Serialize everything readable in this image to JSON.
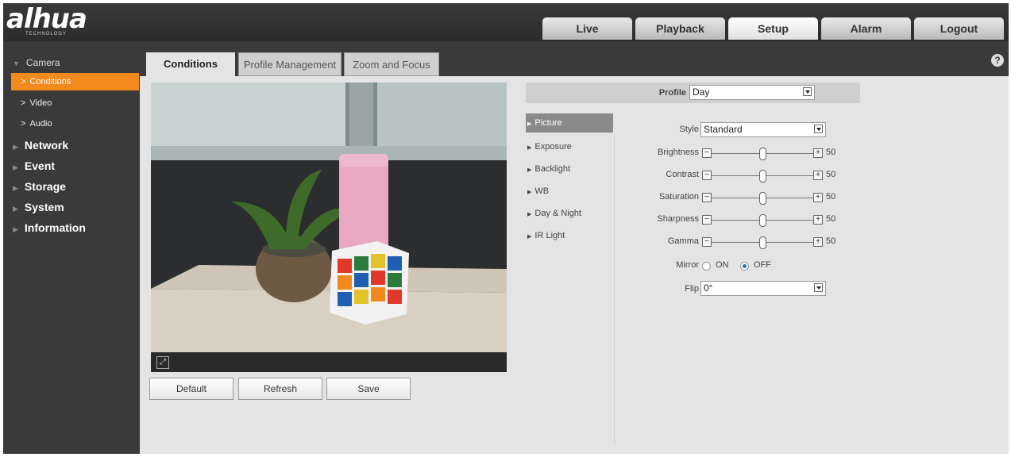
{
  "header": {
    "logo": "alhua",
    "logo_sub": "TECHNOLOGY",
    "tabs": [
      {
        "label": "Live"
      },
      {
        "label": "Playback"
      },
      {
        "label": "Setup"
      },
      {
        "label": "Alarm"
      },
      {
        "label": "Logout"
      }
    ],
    "active_tab": "Setup"
  },
  "sidebar": {
    "camera": "Camera",
    "camera_items": [
      "Conditions",
      "Video",
      "Audio"
    ],
    "active_item": "Conditions",
    "sections": [
      "Network",
      "Event",
      "Storage",
      "System",
      "Information"
    ]
  },
  "subtabs": [
    "Conditions",
    "Profile Management",
    "Zoom and Focus"
  ],
  "help_icon": "?",
  "buttons": {
    "default": "Default",
    "refresh": "Refresh",
    "save": "Save"
  },
  "profile": {
    "label": "Profile",
    "value": "Day"
  },
  "menu": [
    "Picture",
    "Exposure",
    "Backlight",
    "WB",
    "Day & Night",
    "IR Light"
  ],
  "picture": {
    "style": {
      "label": "Style",
      "value": "Standard"
    },
    "sliders": [
      {
        "label": "Brightness",
        "value": "50"
      },
      {
        "label": "Contrast",
        "value": "50"
      },
      {
        "label": "Saturation",
        "value": "50"
      },
      {
        "label": "Sharpness",
        "value": "50"
      },
      {
        "label": "Gamma",
        "value": "50"
      }
    ],
    "mirror": {
      "label": "Mirror",
      "on": "ON",
      "off": "OFF",
      "selected": "OFF"
    },
    "flip": {
      "label": "Flip",
      "value": "0°"
    }
  },
  "colors": {
    "accent": "#f28a1d",
    "header": "#3a3a3a",
    "panel": "#e4e4e4"
  }
}
